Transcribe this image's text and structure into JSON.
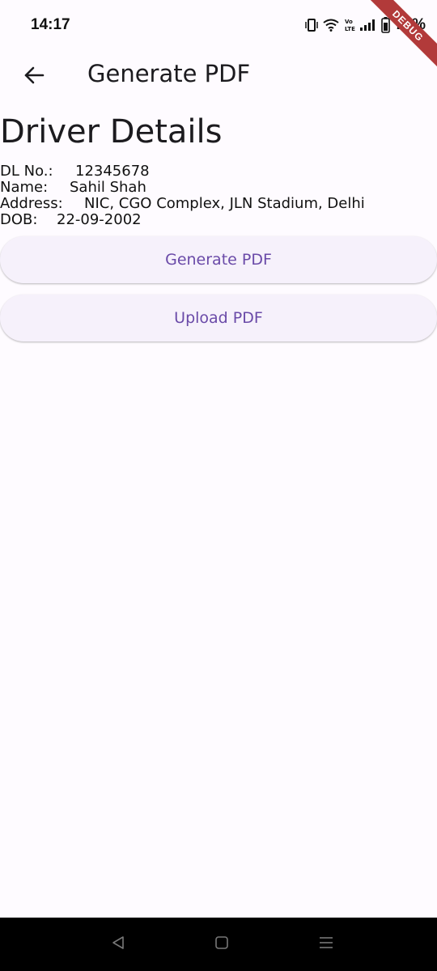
{
  "status_bar": {
    "time": "14:17",
    "battery_text": "78%",
    "icons": [
      "vibrate-icon",
      "wifi-icon",
      "volte-icon",
      "signal-icon",
      "battery-icon"
    ]
  },
  "debug_banner": {
    "label": "DEBUG",
    "color": "#b23a3a"
  },
  "app_bar": {
    "back_icon": "arrow-back-icon",
    "title": "Generate PDF"
  },
  "section": {
    "title": "Driver Details"
  },
  "details": [
    {
      "label": "DL No.:",
      "value": "12345678"
    },
    {
      "label": "Name:",
      "value": "Sahil Shah"
    },
    {
      "label": "Address:",
      "value": "NIC, CGO Complex, JLN Stadium, Delhi"
    },
    {
      "label": "DOB:",
      "value": "22-09-2002"
    }
  ],
  "buttons": {
    "generate_label": "Generate PDF",
    "upload_label": "Upload PDF"
  },
  "colors": {
    "background": "#fefbff",
    "button_bg": "#f6f1fb",
    "button_text": "#6a4aa8",
    "nav_bar": "#000000"
  },
  "nav_bar": {
    "icons": [
      "back-triangle-icon",
      "home-square-icon",
      "recents-menu-icon"
    ]
  }
}
